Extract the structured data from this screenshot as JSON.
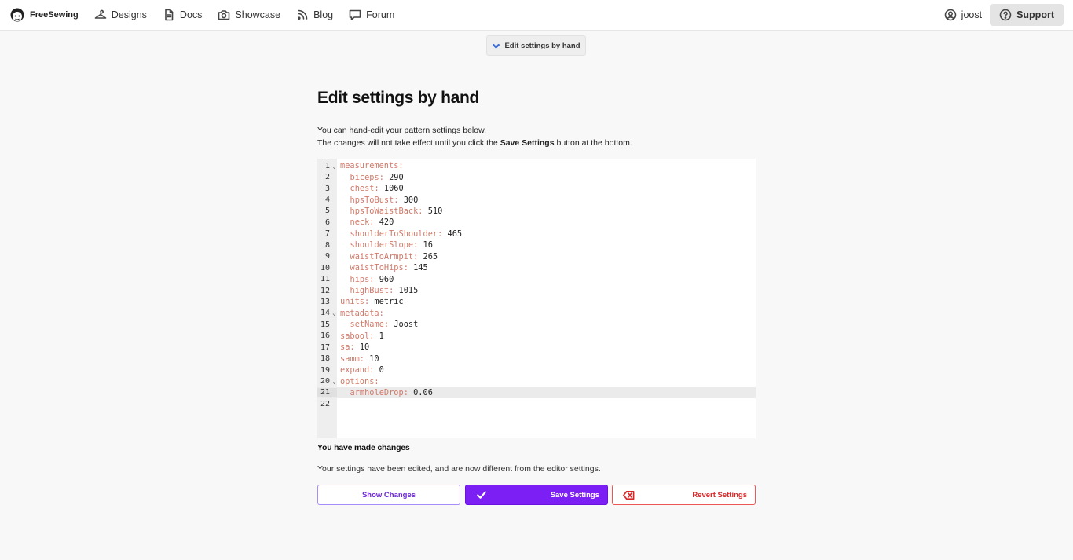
{
  "nav": {
    "brand": "FreeSewing",
    "items": [
      {
        "label": "Designs",
        "icon": "hanger-icon"
      },
      {
        "label": "Docs",
        "icon": "document-icon"
      },
      {
        "label": "Showcase",
        "icon": "camera-icon"
      },
      {
        "label": "Blog",
        "icon": "rss-icon"
      },
      {
        "label": "Forum",
        "icon": "chat-icon"
      }
    ],
    "user": "joost",
    "support": "Support"
  },
  "toggle": {
    "label": "Edit settings by hand"
  },
  "page": {
    "title": "Edit settings by hand",
    "intro_line1": "You can hand-edit your pattern settings below.",
    "intro_line2_pre": "The changes will not take effect until you click the ",
    "intro_line2_bold": "Save Settings",
    "intro_line2_post": " button at the bottom."
  },
  "editor": {
    "lines": [
      {
        "n": "1",
        "fold": true,
        "key": "measurements:",
        "value": "",
        "indent": 0
      },
      {
        "n": "2",
        "key": "biceps:",
        "value": "290",
        "indent": 1
      },
      {
        "n": "3",
        "key": "chest:",
        "value": "1060",
        "indent": 1
      },
      {
        "n": "4",
        "key": "hpsToBust:",
        "value": "300",
        "indent": 1
      },
      {
        "n": "5",
        "key": "hpsToWaistBack:",
        "value": "510",
        "indent": 1
      },
      {
        "n": "6",
        "key": "neck:",
        "value": "420",
        "indent": 1
      },
      {
        "n": "7",
        "key": "shoulderToShoulder:",
        "value": "465",
        "indent": 1
      },
      {
        "n": "8",
        "key": "shoulderSlope:",
        "value": "16",
        "indent": 1
      },
      {
        "n": "9",
        "key": "waistToArmpit:",
        "value": "265",
        "indent": 1
      },
      {
        "n": "10",
        "key": "waistToHips:",
        "value": "145",
        "indent": 1
      },
      {
        "n": "11",
        "key": "hips:",
        "value": "960",
        "indent": 1
      },
      {
        "n": "12",
        "key": "highBust:",
        "value": "1015",
        "indent": 1
      },
      {
        "n": "13",
        "key": "units:",
        "value": "metric",
        "indent": 0
      },
      {
        "n": "14",
        "fold": true,
        "key": "metadata:",
        "value": "",
        "indent": 0
      },
      {
        "n": "15",
        "key": "setName:",
        "value": "Joost",
        "indent": 1
      },
      {
        "n": "16",
        "key": "sabool:",
        "value": "1",
        "indent": 0
      },
      {
        "n": "17",
        "key": "sa:",
        "value": "10",
        "indent": 0
      },
      {
        "n": "18",
        "key": "samm:",
        "value": "10",
        "indent": 0
      },
      {
        "n": "19",
        "key": "expand:",
        "value": "0",
        "indent": 0
      },
      {
        "n": "20",
        "fold": true,
        "key": "options:",
        "value": "",
        "indent": 0
      },
      {
        "n": "21",
        "key": "armholeDrop:",
        "value": "0.06",
        "indent": 1,
        "active": true
      },
      {
        "n": "22",
        "key": "",
        "value": "",
        "indent": 0
      }
    ]
  },
  "changes": {
    "title": "You have made changes",
    "description": "Your settings have been edited, and are now different from the editor settings."
  },
  "buttons": {
    "show": "Show Changes",
    "save": "Save Settings",
    "revert": "Revert Settings"
  },
  "colors": {
    "accent": "#7c1ff4",
    "danger": "#dc2626",
    "yaml_key": "#d07a6a"
  }
}
